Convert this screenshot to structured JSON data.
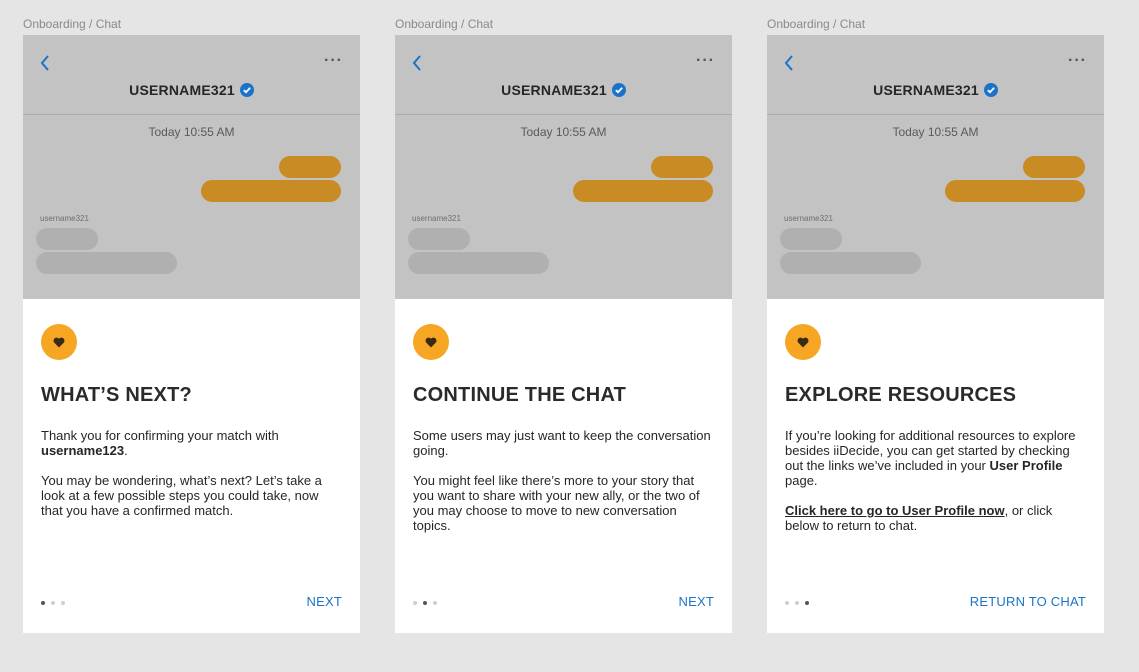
{
  "screens": [
    {
      "frame_label": "Onboarding / Chat",
      "username": "USERNAME321",
      "timestamp": "Today 10:55 AM",
      "sender": "username321",
      "heading": "WHAT’S NEXT?",
      "p1_a": "Thank you for confirming your match with ",
      "p1_bold": "username123",
      "p1_c": ".",
      "p2": "You may be wondering, what’s next? Let’s take a look at a few possible steps you could take, now that you have a confirmed match.",
      "active_dot": 0,
      "button": "NEXT"
    },
    {
      "frame_label": "Onboarding / Chat",
      "username": "USERNAME321",
      "timestamp": "Today 10:55 AM",
      "sender": "username321",
      "heading": "CONTINUE THE CHAT",
      "p1": "Some users may just want to keep the conversation going.",
      "p2": "You might feel like there’s more to your story that you want to share with your new ally, or the two of you may choose to move to new conversation topics.",
      "active_dot": 1,
      "button": "NEXT"
    },
    {
      "frame_label": "Onboarding / Chat",
      "username": "USERNAME321",
      "timestamp": "Today 10:55 AM",
      "sender": "username321",
      "heading": "EXPLORE RESOURCES",
      "p1_a": "If you’re looking for additional resources to explore besides iiDecide, you can get started by checking out the links we’ve included in your ",
      "p1_bold": "User Profile",
      "p1_c": " page.",
      "p2_link": "Click here to go to User Profile now",
      "p2_rest": ", or click below to return to chat.",
      "active_dot": 2,
      "button": "RETURN TO CHAT"
    }
  ],
  "colors": {
    "accent": "#f6a623",
    "outgoing_bubble": "#c98b24",
    "incoming_bubble": "#b0b0b0",
    "link_blue": "#1a73c9",
    "verified_blue": "#1a73c9"
  },
  "icons": [
    "chevron-left-icon",
    "more-horizontal-icon",
    "verified-badge-icon",
    "heart-icon"
  ]
}
